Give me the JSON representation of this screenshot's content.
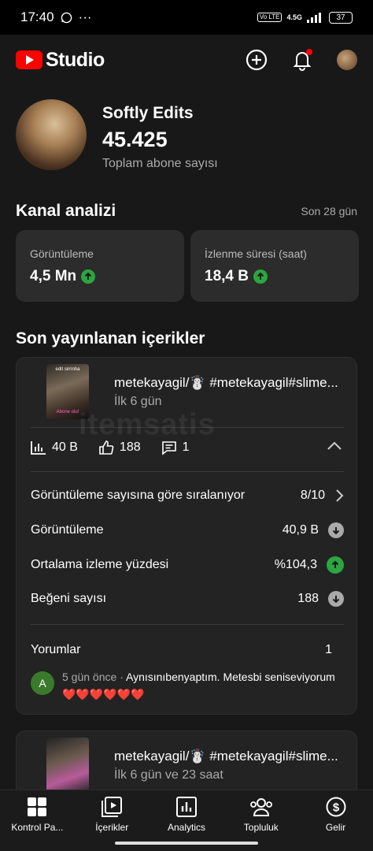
{
  "status_bar": {
    "time": "17:40",
    "more": "···",
    "network_chip": "Vo LTE",
    "network_type": "4.5G",
    "battery": "37"
  },
  "header": {
    "app_name": "Studio",
    "icons": [
      "youtube-logo-icon",
      "create-icon",
      "notifications-icon",
      "account-avatar"
    ],
    "accent_color": "#ff0000"
  },
  "channel": {
    "name": "Softly Edits",
    "subscribers": "45.425",
    "subscribers_label": "Toplam abone sayısı"
  },
  "analytics": {
    "title": "Kanal analizi",
    "period": "Son 28 gün",
    "cards": [
      {
        "label": "Görüntüleme",
        "value": "4,5 Mn",
        "trend": "up"
      },
      {
        "label": "İzlenme süresi (saat)",
        "value": "18,4 B",
        "trend": "up"
      }
    ]
  },
  "recent": {
    "title": "Son yayınlanan içerikler",
    "items": [
      {
        "title": "metekayagil/☃️ #metekayagil#slime...",
        "subtitle": "İlk 6 gün",
        "views": "40 B",
        "likes": "188",
        "comments": "1",
        "metrics": [
          {
            "label": "Görüntüleme sayısına göre sıralanıyor",
            "value": "8/10",
            "icon": "chevron-right"
          },
          {
            "label": "Görüntüleme",
            "value": "40,9 B",
            "icon": "trend-down"
          },
          {
            "label": "Ortalama izleme yüzdesi",
            "value": "%104,3",
            "icon": "trend-up"
          },
          {
            "label": "Beğeni sayısı",
            "value": "188",
            "icon": "trend-down"
          }
        ],
        "comments_label": "Yorumlar",
        "comments_count": "1",
        "top_comment": {
          "avatar_letter": "A",
          "time": "5 gün önce",
          "separator": "·",
          "text": "Aynısınıbenyaptım.  Metesbi seniseviyorum❤️❤️❤️❤️❤️❤️"
        }
      },
      {
        "title": "metekayagil/☃️ #metekayagil#slime...",
        "subtitle": "İlk 6 gün ve 23 saat"
      }
    ]
  },
  "bottom_nav": [
    {
      "label": "Kontrol Pa...",
      "icon": "dashboard-icon"
    },
    {
      "label": "İçerikler",
      "icon": "content-icon"
    },
    {
      "label": "Analytics",
      "icon": "analytics-icon"
    },
    {
      "label": "Topluluk",
      "icon": "community-icon"
    },
    {
      "label": "Gelir",
      "icon": "earn-icon"
    }
  ],
  "watermark": "itemsatis"
}
